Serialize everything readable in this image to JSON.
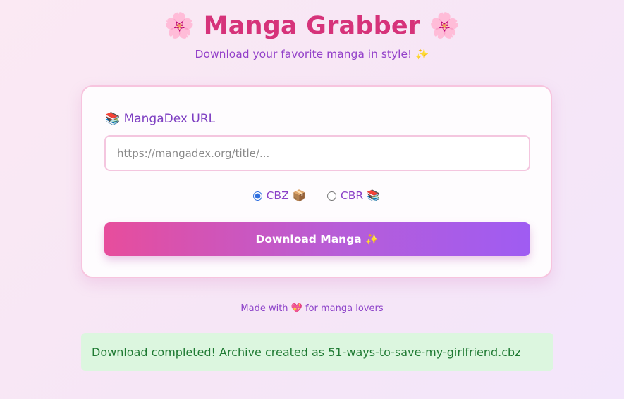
{
  "header": {
    "title": "🌸 Manga Grabber 🌸",
    "subtitle": "Download your favorite manga in style! ✨"
  },
  "form": {
    "url_label": "📚 MangaDex URL",
    "url_placeholder": "https://mangadex.org/title/...",
    "url_value": "",
    "formats": [
      {
        "label": "CBZ 📦",
        "value": "cbz",
        "selected": true
      },
      {
        "label": "CBR 📚",
        "value": "cbr",
        "selected": false
      }
    ],
    "download_label": "Download Manga ✨"
  },
  "footer": {
    "note": "Made with 💖 for manga lovers"
  },
  "status": {
    "message": "Download completed! Archive created as 51-ways-to-save-my-girlfriend.cbz",
    "type": "success"
  },
  "colors": {
    "title": "#d6337a",
    "accent_purple": "#7e3fc2",
    "button_gradient_start": "#e74d9c",
    "button_gradient_end": "#9f5cf2",
    "success_bg": "#dcf6df",
    "success_text": "#1f7a33"
  }
}
